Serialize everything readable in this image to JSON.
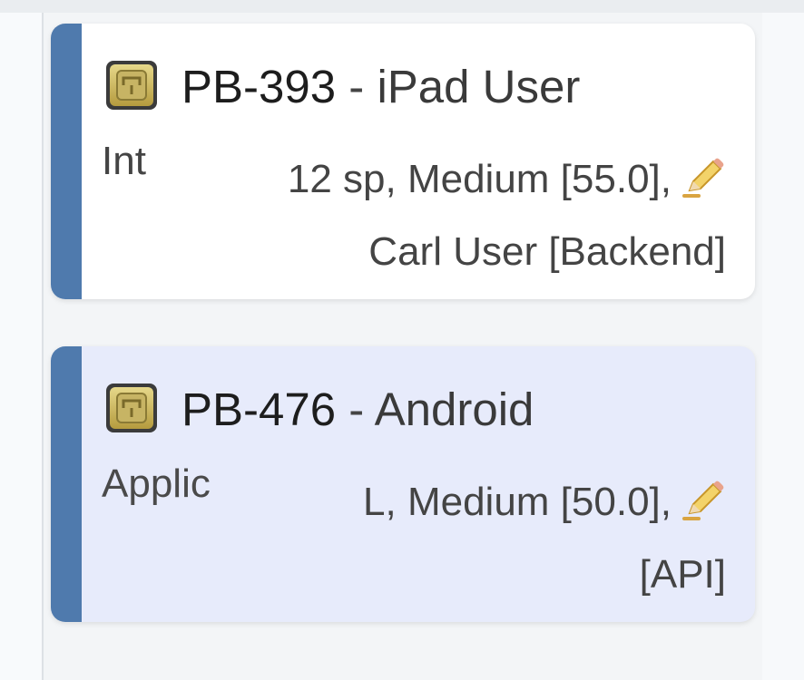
{
  "cards": [
    {
      "key": "PB-393",
      "separator": "-",
      "summary": "iPad User",
      "description": "Int",
      "estimate_line": "12 sp, Medium [55.0],",
      "assignee_line": "Carl User [Backend]",
      "issue_type_icon": "story-icon",
      "edit_icon": "pencil-icon"
    },
    {
      "key": "PB-476",
      "separator": "-",
      "summary": "Android",
      "description": "Applic",
      "estimate_line": "L, Medium [50.0],",
      "assignee_line": "[API]",
      "issue_type_icon": "story-icon",
      "edit_icon": "pencil-icon"
    }
  ],
  "colors": {
    "stripe": "#4f7aad",
    "card_default_bg": "#ffffff",
    "card_selected_bg": "#e7ebfb",
    "icon_gold": "#c9b35a"
  }
}
